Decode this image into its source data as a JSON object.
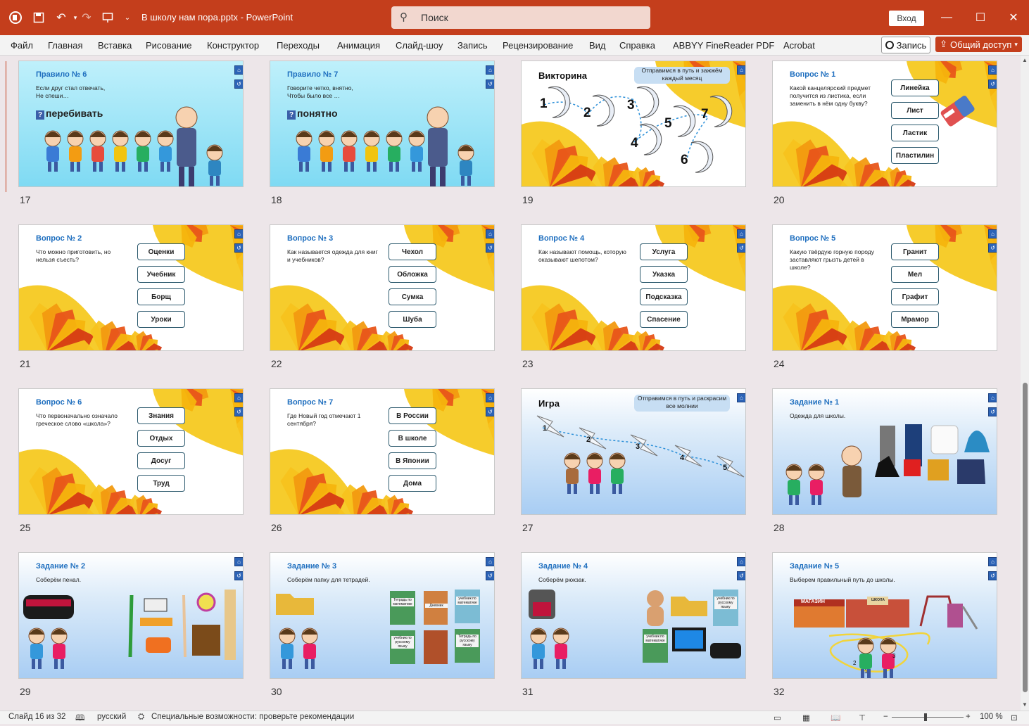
{
  "app": {
    "doc_title": "В школу нам пора.pptx  -  PowerPoint",
    "search_placeholder": "Поиск",
    "signin_label": "Вход",
    "accent": "#c43e1c"
  },
  "ribbon": {
    "tabs": [
      "Файл",
      "Главная",
      "Вставка",
      "Рисование",
      "Конструктор",
      "Переходы",
      "Анимация",
      "Слайд-шоу",
      "Запись",
      "Рецензирование",
      "Вид",
      "Справка",
      "ABBYY FineReader PDF",
      "Acrobat"
    ],
    "record_label": "Запись",
    "share_label": "Общий доступ"
  },
  "slides": [
    {
      "num": "17",
      "title": "Правило № 6",
      "text": "Если друг стал отвечать,\nНе спеши…",
      "big": "перебивать"
    },
    {
      "num": "18",
      "title": "Правило № 7",
      "text": "Говорите четко, внятно,\nЧтобы было все …",
      "big": "понятно"
    },
    {
      "num": "19",
      "title": "Викторина",
      "cloud": "Отправимся в путь и зажжём каждый месяц",
      "numbers": [
        "1",
        "2",
        "3",
        "4",
        "5",
        "7",
        "6"
      ]
    },
    {
      "num": "20",
      "title": "Вопрос № 1",
      "text": "Какой канцелярский предмет получится из листика, если заменить в нём одну букву?",
      "answers": [
        "Линейка",
        "Лист",
        "Ластик",
        "Пластилин"
      ]
    },
    {
      "num": "21",
      "title": "Вопрос № 2",
      "text": "Что можно приготовить, но нельзя съесть?",
      "answers": [
        "Оценки",
        "Учебник",
        "Борщ",
        "Уроки"
      ]
    },
    {
      "num": "22",
      "title": "Вопрос № 3",
      "text": "Как называется одежда для книг и учебников?",
      "answers": [
        "Чехол",
        "Обложка",
        "Сумка",
        "Шуба"
      ]
    },
    {
      "num": "23",
      "title": "Вопрос № 4",
      "text": "Как называют помощь, которую оказывают шепотом?",
      "answers": [
        "Услуга",
        "Указка",
        "Подсказка",
        "Спасение"
      ]
    },
    {
      "num": "24",
      "title": "Вопрос № 5",
      "text": "Какую твёрдую горную породу заставляют грызть детей в школе?",
      "answers": [
        "Гранит",
        "Мел",
        "Графит",
        "Мрамор"
      ]
    },
    {
      "num": "25",
      "title": "Вопрос № 6",
      "text": "Что первоначально означало греческое слово «школа»?",
      "answers": [
        "Знания",
        "Отдых",
        "Досуг",
        "Труд"
      ]
    },
    {
      "num": "26",
      "title": "Вопрос № 7",
      "text": "Где Новый год отмечают 1 сентября?",
      "answers": [
        "В России",
        "В школе",
        "В Японии",
        "Дома"
      ]
    },
    {
      "num": "27",
      "title": "Игра",
      "cloud": "Отправимся в путь и раскрасим все молнии",
      "numbers": [
        "1",
        "2",
        "3",
        "4",
        "5"
      ]
    },
    {
      "num": "28",
      "title": "Задание № 1",
      "text": "Одежда для школы."
    },
    {
      "num": "29",
      "title": "Задание № 2",
      "text": "Соберём пенал."
    },
    {
      "num": "30",
      "title": "Задание № 3",
      "text": "Соберём папку для тетрадей.",
      "books": [
        "Тетрадь по математике",
        "Дневник",
        "учебник по математике",
        "учебник по русскому языку",
        "",
        "Тетрадь по русскому языку"
      ]
    },
    {
      "num": "31",
      "title": "Задание № 4",
      "text": "Соберём рюкзак.",
      "books": [
        "учебник по математике",
        "учебник по русскому языку"
      ]
    },
    {
      "num": "32",
      "title": "Задание № 5",
      "text": "Выберем правильный путь до школы.",
      "labels": [
        "МАГАЗИН",
        "ШКОЛА"
      ],
      "numbers": [
        "2",
        "3",
        "1"
      ]
    }
  ],
  "status": {
    "slide_info": "Слайд 16 из 32",
    "language": "русский",
    "accessibility": "Специальные возможности: проверьте рекомендации",
    "zoom": "100 %"
  }
}
